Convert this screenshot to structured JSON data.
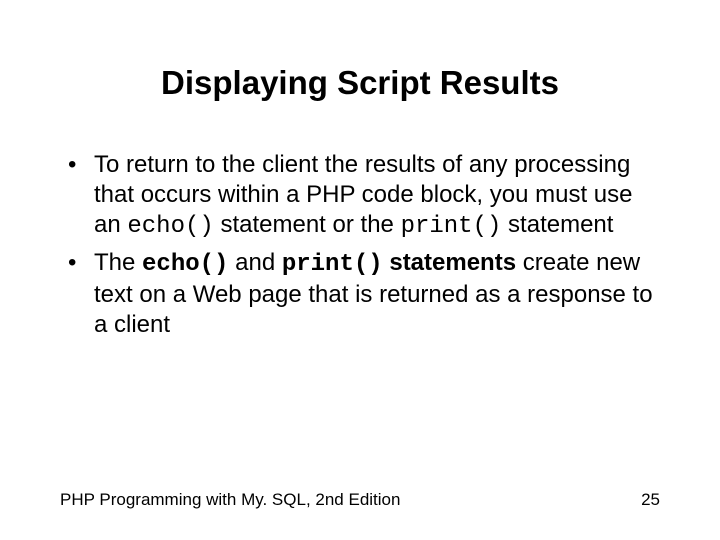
{
  "title": "Displaying Script Results",
  "b1": {
    "p1": "To return to the client the results of any processing that occurs within a PHP code block, you must use an ",
    "c1": "echo()",
    "p2": " statement or the ",
    "c2": "print()",
    "p3": " statement"
  },
  "b2": {
    "p1": "The ",
    "c1": "echo()",
    "p2": " and ",
    "c2": "print()",
    "p3": " statements",
    "p4": " create new text on a Web page that is returned as a response to a client"
  },
  "footer": {
    "book": "PHP Programming with My. SQL, 2nd Edition",
    "page": "25"
  }
}
